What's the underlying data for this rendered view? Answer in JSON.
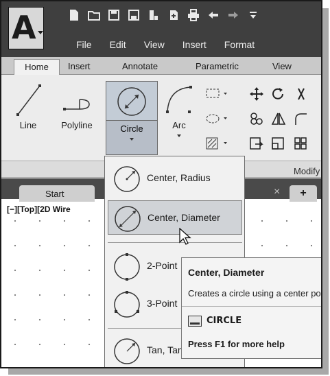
{
  "app": {
    "logo_letter": "A"
  },
  "menubar": [
    "File",
    "Edit",
    "View",
    "Insert",
    "Format"
  ],
  "ribbon_tabs": [
    "Home",
    "Insert",
    "Annotate",
    "Parametric",
    "View"
  ],
  "draw_tools": {
    "line": "Line",
    "polyline": "Polyline",
    "circle": "Circle",
    "arc": "Arc"
  },
  "panel_titles": {
    "modify": "Modify"
  },
  "file_tabs": {
    "start": "Start",
    "close": "×",
    "new": "+"
  },
  "viewport_label": "[−][Top][2D Wire",
  "circle_menu": [
    {
      "label": "Center, Radius",
      "state": "normal"
    },
    {
      "label": "Center, Diameter",
      "state": "hover"
    },
    {
      "label": "2-Point",
      "state": "normal"
    },
    {
      "label": "3-Point",
      "state": "normal"
    },
    {
      "label": "Tan, Tan, Radius",
      "state": "normal"
    }
  ],
  "tooltip": {
    "title": "Center, Diameter",
    "description": "Creates a circle using a center point and a diameter",
    "command": "CIRCLE",
    "help": "Press F1 for more help"
  },
  "colors": {
    "titlebar": "#3f3f3f",
    "ribbon": "#ececec",
    "hover": "#d0d3d7",
    "button_selected": "#c3ccd6"
  }
}
